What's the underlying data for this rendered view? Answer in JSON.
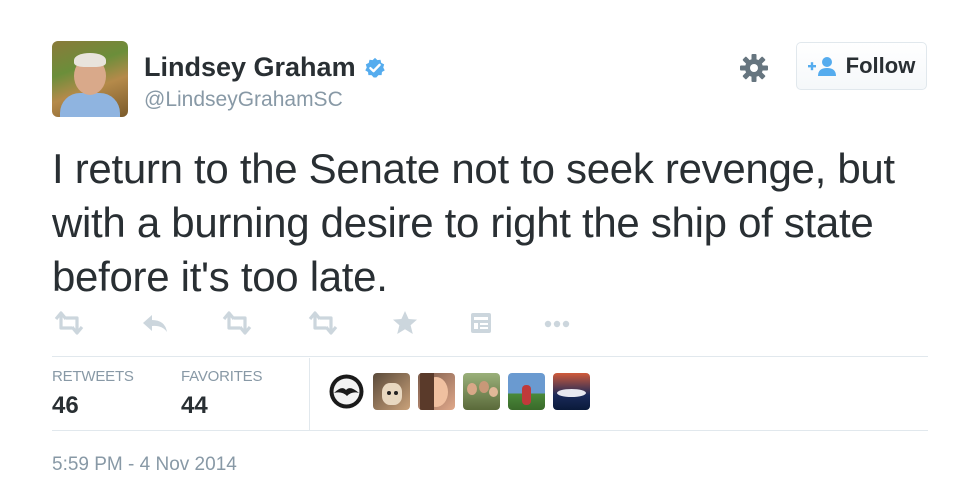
{
  "author": {
    "name": "Lindsey Graham",
    "handle": "@LindseyGrahamSC",
    "verified": true
  },
  "follow_button": {
    "label": "Follow"
  },
  "tweet": {
    "text": "I return to the Senate not to seek revenge, but with a burning desire to right the ship of state before it's too late."
  },
  "actions": [
    "retweet-icon",
    "reply-icon",
    "retweet-icon",
    "retweet-icon",
    "favorite-star-icon",
    "embed-icon",
    "more-icon"
  ],
  "stats": {
    "retweets_label": "RETWEETS",
    "retweets_value": "46",
    "favorites_label": "FAVORITES",
    "favorites_value": "44"
  },
  "favoriters": [
    {
      "icon": "avatar-eagle",
      "color": "#1a1a1a"
    },
    {
      "icon": "avatar-dog",
      "color": "#8a6a4a"
    },
    {
      "icon": "avatar-person",
      "color": "#c98a6a"
    },
    {
      "icon": "avatar-family",
      "color": "#6a8a5a"
    },
    {
      "icon": "avatar-outdoor",
      "color": "#4a7ab0"
    },
    {
      "icon": "avatar-stadium",
      "color": "#b04a3a"
    }
  ],
  "timestamp": "5:59 PM - 4 Nov 2014",
  "colors": {
    "text": "#292f33",
    "muted": "#8899a6",
    "verified_blue": "#55acee",
    "action_gray": "#ccd6dd",
    "border": "#e1e8ed"
  }
}
